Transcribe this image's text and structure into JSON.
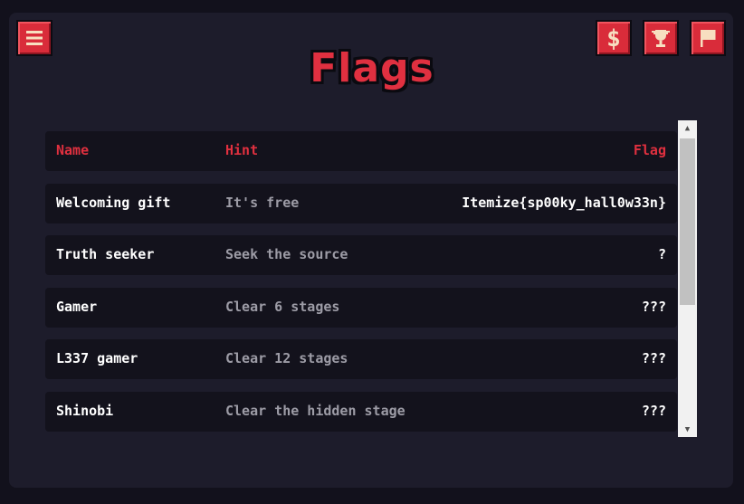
{
  "title": "Flags",
  "toolbar": {
    "menu_icon": "hamburger-menu-icon",
    "shop_icon": "dollar-icon",
    "trophy_icon": "trophy-icon",
    "flag_icon": "flag-icon"
  },
  "table": {
    "headers": {
      "name": "Name",
      "hint": "Hint",
      "flag": "Flag"
    },
    "rows": [
      {
        "name": "Welcoming gift",
        "hint": "It's free",
        "flag": "Itemize{sp00ky_hall0w33n}"
      },
      {
        "name": "Truth seeker",
        "hint": "Seek the source",
        "flag": "?"
      },
      {
        "name": "Gamer",
        "hint": "Clear 6 stages",
        "flag": "???"
      },
      {
        "name": "L337 gamer",
        "hint": "Clear 12 stages",
        "flag": "???"
      },
      {
        "name": "Shinobi",
        "hint": "Clear the hidden stage",
        "flag": "???"
      }
    ]
  },
  "colors": {
    "accent": "#e0303f",
    "panel": "#1d1c2b",
    "row": "#13121c",
    "hint_text": "#9d9ca6"
  }
}
